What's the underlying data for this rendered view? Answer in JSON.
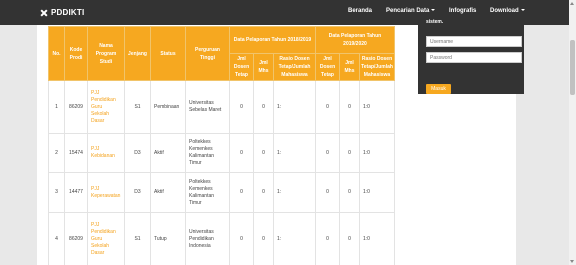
{
  "navbar": {
    "brand": "PDDIKTI",
    "items": [
      {
        "label": "Beranda",
        "dropdown": false
      },
      {
        "label": "Pencarian Data",
        "dropdown": true
      },
      {
        "label": "Infografis",
        "dropdown": false
      },
      {
        "label": "Download",
        "dropdown": true
      }
    ]
  },
  "login": {
    "text": "sistem.",
    "username_placeholder": "Username",
    "password_placeholder": "Password",
    "button": "Masuk"
  },
  "table": {
    "headers": {
      "no": "No.",
      "kode_prodi": "Kode Prodi",
      "nama_program_studi": "Nama Program Studi",
      "jenjang": "Jenjang",
      "status": "Status",
      "perguruan_tinggi": "Perguruan Tinggi",
      "group1": "Data Pelaporan Tahun 2018/2019",
      "group2": "Data Pelaporan Tahun 2019/2020",
      "jml_dosen_tetap": "Jml Dosen Tetap",
      "jml_mhs": "Jml Mhs",
      "rasio": "Rasio Dosen Tetap/Jumlah Mahasiswa"
    },
    "rows": [
      {
        "no": "1",
        "kode": "86209",
        "prodi": "PJJ Pendidikan Guru Sekolah Dasar",
        "jenjang": "S1",
        "status": "Pembinaan",
        "pt": "Universitas Sebelas Maret",
        "d1": "0",
        "m1": "0",
        "r1": "1:",
        "d2": "0",
        "m2": "0",
        "r2": "1:0"
      },
      {
        "no": "2",
        "kode": "15474",
        "prodi": "PJJ Kebidanan",
        "jenjang": "D3",
        "status": "Aktif",
        "pt": "Poltekkes Kemenkes Kalimantan Timur",
        "d1": "0",
        "m1": "0",
        "r1": "1:",
        "d2": "0",
        "m2": "0",
        "r2": "1:0"
      },
      {
        "no": "3",
        "kode": "14477",
        "prodi": "PJJ Keperawatan",
        "jenjang": "D3",
        "status": "Aktif",
        "pt": "Poltekkes Kemenkes Kalimantan Timur",
        "d1": "0",
        "m1": "0",
        "r1": "1:",
        "d2": "0",
        "m2": "0",
        "r2": "1:0"
      },
      {
        "no": "4",
        "kode": "86209",
        "prodi": "PJJ Pendidikan Guru Sekolah Dasar",
        "jenjang": "S1",
        "status": "Tutup",
        "pt": "Universitas Pendidikan Indonesia",
        "d1": "0",
        "m1": "0",
        "r1": "1:",
        "d2": "0",
        "m2": "0",
        "r2": "1:0"
      }
    ]
  }
}
